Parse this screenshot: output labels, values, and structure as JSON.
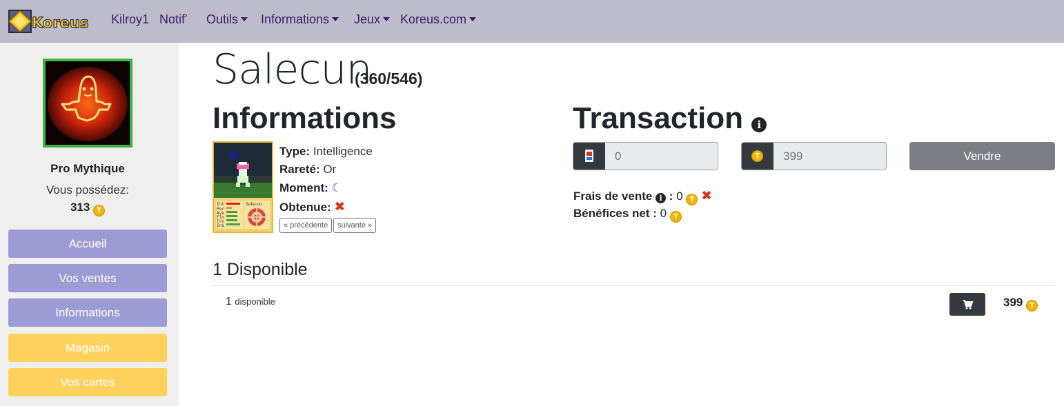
{
  "navbar": {
    "logo_text": "Koreus",
    "items": [
      {
        "label": "Kilroy1",
        "dropdown": false
      },
      {
        "label": "Notif'",
        "dropdown": false
      },
      {
        "label": "Outils",
        "dropdown": true
      },
      {
        "label": "Informations",
        "dropdown": true
      },
      {
        "label": "Jeux",
        "dropdown": true
      },
      {
        "label": "Koreus.com",
        "dropdown": true
      }
    ]
  },
  "sidebar": {
    "rank": "Pro Mythique",
    "owned_label": "Vous possédez:",
    "owned_value": "313",
    "buttons": [
      {
        "label": "Accueil",
        "color": "#9d9bd4"
      },
      {
        "label": "Vos ventes",
        "color": "#9d9bd4"
      },
      {
        "label": "Informations",
        "color": "#9d9bd4"
      },
      {
        "label": "Magasin",
        "color": "#fdd25c"
      },
      {
        "label": "Vos cartes",
        "color": "#fdd25c"
      }
    ]
  },
  "card": {
    "name": "Salecun",
    "count": "(360/546)",
    "info_heading": "Informations",
    "props": [
      {
        "label": "Type:",
        "value": "Intelligence"
      },
      {
        "label": "Rareté:",
        "value": "Or"
      },
      {
        "label": "Moment:",
        "value": "☾"
      },
      {
        "label": "Obtenue:",
        "value": "✖"
      }
    ],
    "prev_label": "« précédente",
    "next_label": "suivante »",
    "image_stats": [
      "Int",
      "Per",
      "Ave",
      "Flo",
      "Tro",
      "Ins"
    ],
    "image_name": "Salecun"
  },
  "transaction": {
    "heading": "Transaction",
    "quantity_value": "0",
    "price_value": "399",
    "sell_label": "Vendre",
    "fees_label": "Frais de vente",
    "fees_value": "0",
    "net_label": "Bénéfices net :",
    "net_value": "0"
  },
  "available": {
    "heading": "1 Disponible",
    "row_count": "1",
    "row_label": "disponible",
    "row_price": "399"
  },
  "icons": {
    "coin": "coin-icon",
    "info": "info-circle-icon",
    "cart": "cart-icon",
    "cross": "cross-icon",
    "moon": "moon-icon",
    "card": "card-icon"
  },
  "colors": {
    "navbar_bg": "#bdbccb",
    "nav_text": "#3d1a6b",
    "sidebar_bg": "#efefef",
    "purple_button": "#9d9bd4",
    "yellow_button": "#fdd25c",
    "dark": "#343a40",
    "sell_button": "#7b7f85",
    "coin": "#f4b400",
    "cross": "#d9321f",
    "moon": "#8a3ab9",
    "avatar_border": "#3bb33b"
  }
}
